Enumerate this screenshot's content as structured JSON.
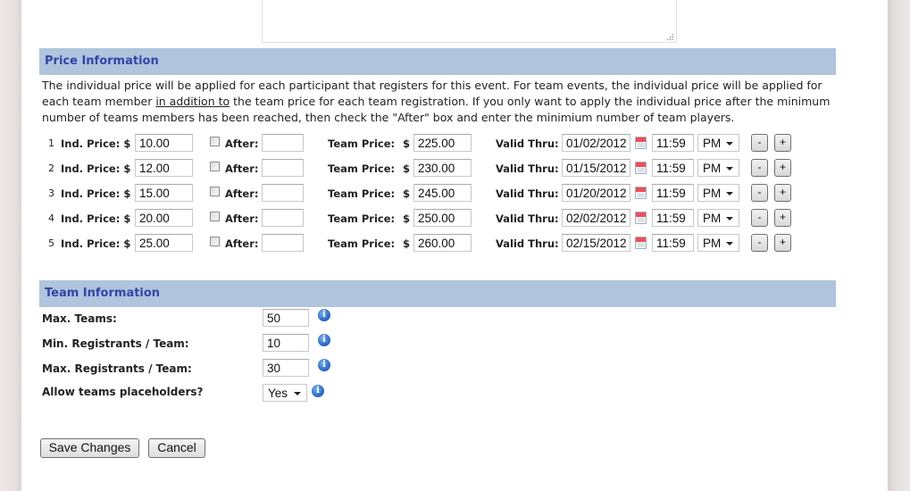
{
  "description_field": {
    "value": ""
  },
  "price_section": {
    "title": "Price Information",
    "description": {
      "part1": "The individual price will be applied for each participant that registers for this event. For team events, the individual price will be applied for each team member ",
      "underlined": "in addition to",
      "part2": " the team price for each team registration. If you only want to apply the individual price after the minimum number of teams members has been reached, then check the \"After\" box and enter the minimium number of team players."
    },
    "labels": {
      "ind_price": "Ind. Price: $",
      "after": "After:",
      "team_price": "Team Price:",
      "currency": "$",
      "valid_thru": "Valid Thru:",
      "remove": "-",
      "add": "+"
    },
    "rows": [
      {
        "num": "1",
        "ind_price": "10.00",
        "after_checked": false,
        "after_value": "",
        "team_price": "225.00",
        "valid_date": "01/02/2012",
        "time": "11:59",
        "ampm": "PM"
      },
      {
        "num": "2",
        "ind_price": "12.00",
        "after_checked": false,
        "after_value": "",
        "team_price": "230.00",
        "valid_date": "01/15/2012",
        "time": "11:59",
        "ampm": "PM"
      },
      {
        "num": "3",
        "ind_price": "15.00",
        "after_checked": false,
        "after_value": "",
        "team_price": "245.00",
        "valid_date": "01/20/2012",
        "time": "11:59",
        "ampm": "PM"
      },
      {
        "num": "4",
        "ind_price": "20.00",
        "after_checked": false,
        "after_value": "",
        "team_price": "250.00",
        "valid_date": "02/02/2012",
        "time": "11:59",
        "ampm": "PM"
      },
      {
        "num": "5",
        "ind_price": "25.00",
        "after_checked": false,
        "after_value": "",
        "team_price": "260.00",
        "valid_date": "02/15/2012",
        "time": "11:59",
        "ampm": "PM"
      }
    ]
  },
  "team_section": {
    "title": "Team Information",
    "fields": [
      {
        "label": "Max. Teams:",
        "value": "50",
        "type": "input"
      },
      {
        "label": "Min. Registrants / Team:",
        "value": "10",
        "type": "input"
      },
      {
        "label": "Max. Registrants / Team:",
        "value": "30",
        "type": "input"
      },
      {
        "label": "Allow teams placeholders?",
        "value": "Yes",
        "type": "select"
      }
    ],
    "info_glyph": "i"
  },
  "actions": {
    "save_label": "Save Changes",
    "cancel_label": "Cancel"
  },
  "colors": {
    "section_header_bg": "#b0c4de",
    "section_header_text": "#3344a8"
  }
}
